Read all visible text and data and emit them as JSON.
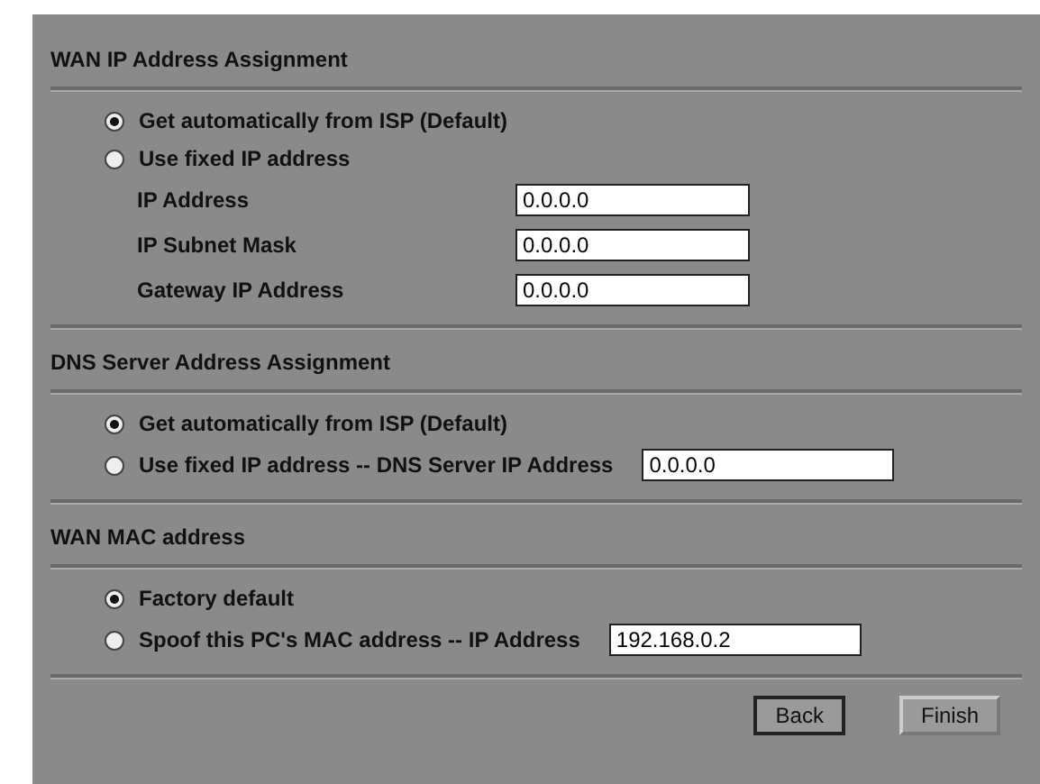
{
  "sections": [
    {
      "title": "WAN IP Address Assignment",
      "options": [
        {
          "label": "Get automatically from ISP (Default)",
          "selected": true
        },
        {
          "label": "Use fixed IP address",
          "selected": false
        }
      ],
      "fields": [
        {
          "label": "IP Address",
          "value": "0.0.0.0"
        },
        {
          "label": "IP Subnet Mask",
          "value": "0.0.0.0"
        },
        {
          "label": "Gateway IP Address",
          "value": "0.0.0.0"
        }
      ]
    },
    {
      "title": "DNS Server Address Assignment",
      "options": [
        {
          "label": "Get automatically from ISP (Default)",
          "selected": true
        },
        {
          "label": "Use fixed IP address -- DNS Server IP Address",
          "selected": false,
          "value": "0.0.0.0"
        }
      ]
    },
    {
      "title": "WAN MAC address",
      "options": [
        {
          "label": "Factory default",
          "selected": true
        },
        {
          "label": "Spoof this PC's MAC address -- IP Address",
          "selected": false,
          "value": "192.168.0.2"
        }
      ]
    }
  ],
  "buttons": [
    {
      "label": "Back",
      "selected": true
    },
    {
      "label": "Finish",
      "selected": false
    }
  ]
}
